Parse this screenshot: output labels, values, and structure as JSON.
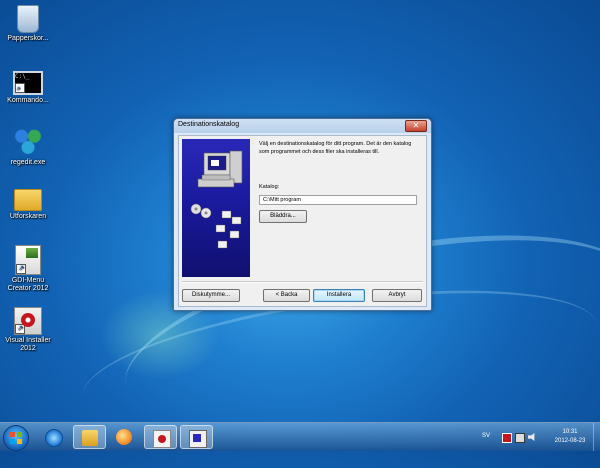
{
  "desktop": {
    "icons": [
      {
        "label": "Papperskor..."
      },
      {
        "label": "Kommando..."
      },
      {
        "label": "regedit.exe"
      },
      {
        "label": "Utforskaren"
      },
      {
        "label": "GDI-Menu Creator 2012"
      },
      {
        "label": "Visual Installer 2012"
      }
    ]
  },
  "dialog": {
    "title": "Destinationskatalog",
    "close_glyph": "✕",
    "description": "Välj en destinationskatalog för ditt program. Det är den katalog som programmet och dess filer ska installeras till.",
    "folder_label": "Katalog:",
    "folder_value": "C:\\Mitt program",
    "browse_label": "Bläddra...",
    "buttons": {
      "disk_label": "Diskutymme...",
      "back_label": "< Backa",
      "install_label": "Installera",
      "cancel_label": "Avbryt"
    }
  },
  "taskbar": {
    "language": "SV",
    "time": "10:31",
    "date": "2012-08-23"
  },
  "colors": {
    "banner": "#1a1a9e",
    "taskbar": "#1e5090"
  }
}
